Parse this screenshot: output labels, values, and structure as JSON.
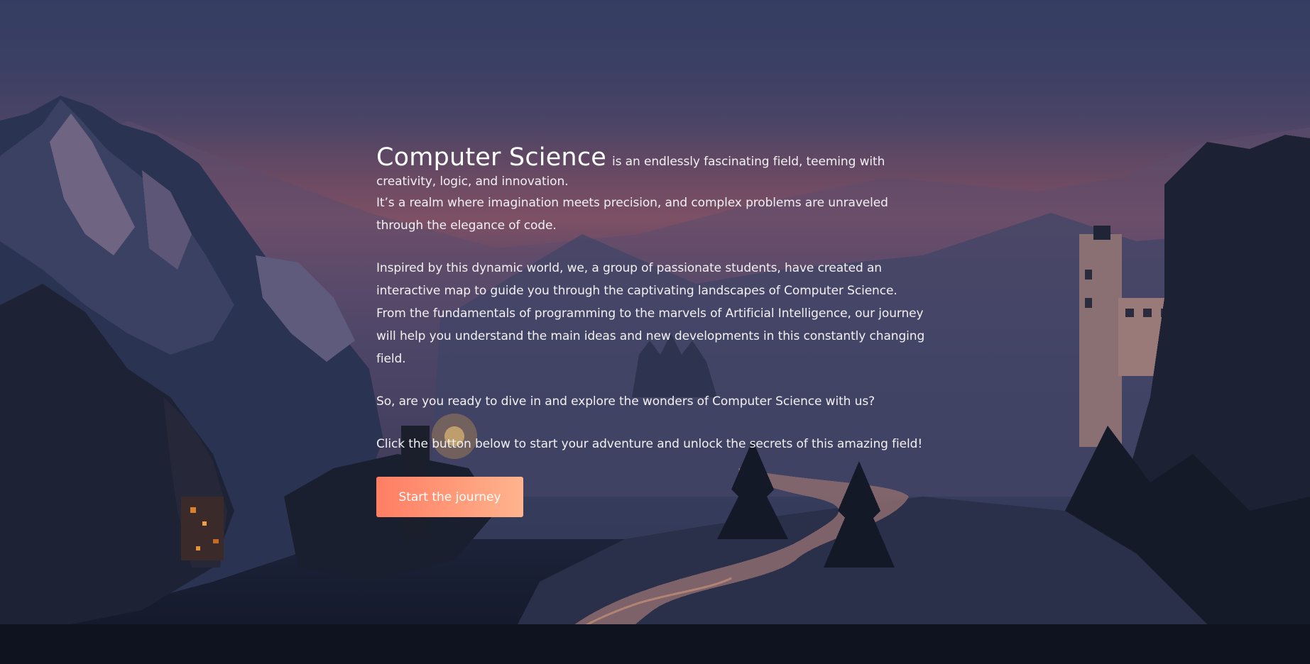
{
  "hero": {
    "title": "Computer Science",
    "intro_tail": "is an endlessly fascinating field, teeming with creativity, logic, and innovation.",
    "intro_line2": "It’s a realm where imagination meets precision, and complex problems are unraveled through the elegance of code.",
    "para2_line1": "Inspired by this dynamic world, we, a group of passionate students, have created an interactive map to guide you through the captivating landscapes of Computer Science.",
    "para2_line2": "From the fundamentals of programming to the marvels of Artificial Intelligence, our journey will help you understand the main ideas and new developments in this constantly changing field.",
    "question": "So, are you ready to dive in and explore the wonders of Computer Science with us?",
    "cta_text": "Click the button below to start your adventure and unlock the secrets of this amazing field!",
    "button_label": "Start the journey"
  },
  "colors": {
    "button_start": "#ff7d63",
    "button_end": "#ffb48e",
    "text": "#f2f0f2"
  },
  "background": {
    "description_icon": "pixel-art-mountain-landscape"
  }
}
